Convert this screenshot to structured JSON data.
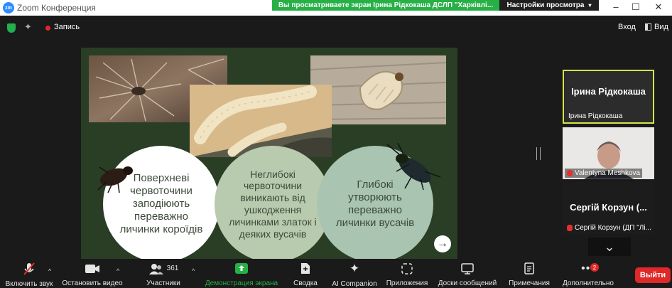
{
  "titlebar": {
    "title": "Zoom Конференция",
    "logo_text": "zm",
    "share_banner": "Вы просматриваете экран Ірина Рідкокаша ДСЛП \"Харківлі...",
    "view_options": "Настройки просмотра",
    "minimize_icon": "minimize-icon",
    "maximize_icon": "maximize-icon",
    "close_icon": "close-icon"
  },
  "topbar": {
    "record_label": "Запись",
    "enter_label": "Вход",
    "view_label": "Вид"
  },
  "slide": {
    "circle1": "Поверхневі червоточини заподіюють переважно личинки короїдів",
    "circle2": "Неглибокі червоточини виникають від ушкодження личинками златок і деяких вусачів",
    "circle3": "Глибокі утворюють переважно личинки вусачів",
    "next_arrow": "→",
    "colors": {
      "background": "#293e25",
      "circle1": "#ffffff",
      "circle2": "#b9cbae",
      "circle3": "#a9c4b1"
    }
  },
  "participants": {
    "tile1": {
      "big_name": "Ірина Рідкокаша",
      "name": "Ірина Рідкокаша"
    },
    "tile2": {
      "name": "Valentyna Meshkova"
    },
    "tile3": {
      "big_name": "Сергій Корзун (...",
      "name": "Сергій Корзун (ДП \"Лі..."
    },
    "more_chevron": "⌄"
  },
  "toolbar": {
    "unmute": "Включить звук",
    "stop_video": "Остановить видео",
    "participants": "Участники",
    "participants_count": "361",
    "share_screen": "Демонстрация экрана",
    "summary": "Сводка",
    "ai_companion": "AI Companion",
    "apps": "Приложения",
    "whiteboards": "Доски сообщений",
    "notes": "Примечания",
    "more": "Дополнительно",
    "more_badge": "2",
    "leave": "Выйти",
    "colors": {
      "share_accent": "#26b046",
      "leave": "#e02828"
    }
  }
}
